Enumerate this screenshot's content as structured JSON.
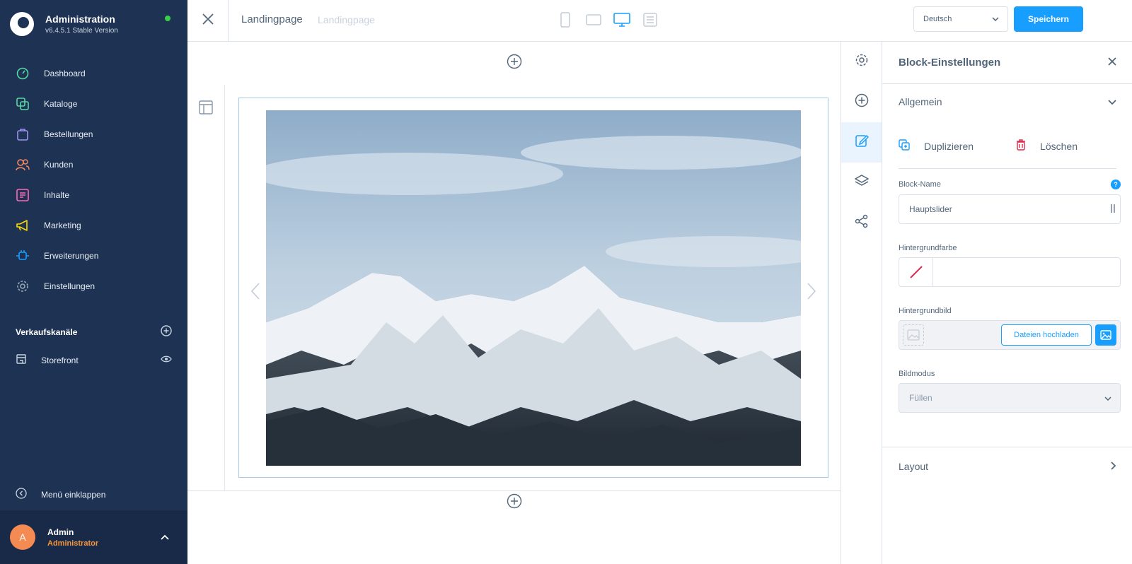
{
  "app": {
    "title": "Administration",
    "version": "v6.4.5.1 Stable Version"
  },
  "nav": {
    "items": [
      {
        "label": "Dashboard",
        "icon": "dashboard-icon",
        "color": "#57d9a3"
      },
      {
        "label": "Kataloge",
        "icon": "catalog-icon",
        "color": "#57d9a3"
      },
      {
        "label": "Bestellungen",
        "icon": "orders-icon",
        "color": "#a092f0"
      },
      {
        "label": "Kunden",
        "icon": "customers-icon",
        "color": "#f88962"
      },
      {
        "label": "Inhalte",
        "icon": "content-icon",
        "color": "#ff68b4"
      },
      {
        "label": "Marketing",
        "icon": "marketing-icon",
        "color": "#ffd700"
      },
      {
        "label": "Erweiterungen",
        "icon": "extensions-icon",
        "color": "#189eff"
      },
      {
        "label": "Einstellungen",
        "icon": "settings-icon",
        "color": "#9aa8b5"
      }
    ]
  },
  "sales_channels": {
    "heading": "Verkaufskanäle",
    "items": [
      {
        "label": "Storefront"
      }
    ]
  },
  "collapse_label": "Menü einklappen",
  "user": {
    "initial": "A",
    "name": "Admin",
    "role": "Administrator"
  },
  "topbar": {
    "title": "Landingpage",
    "subtitle": "Landingpage",
    "language": "Deutsch",
    "save_label": "Speichern"
  },
  "panel": {
    "title": "Block-Einstellungen",
    "general_label": "Allgemein",
    "duplicate_label": "Duplizieren",
    "delete_label": "Löschen",
    "block_name_label": "Block-Name",
    "block_name_value": "Hauptslider",
    "bg_color_label": "Hintergrundfarbe",
    "bg_image_label": "Hintergrundbild",
    "upload_label": "Dateien hochladen",
    "image_mode_label": "Bildmodus",
    "image_mode_value": "Füllen",
    "layout_label": "Layout"
  },
  "colors": {
    "sidebar_bg": "#1e3354",
    "accent": "#189eff",
    "status_online": "#37d046"
  }
}
